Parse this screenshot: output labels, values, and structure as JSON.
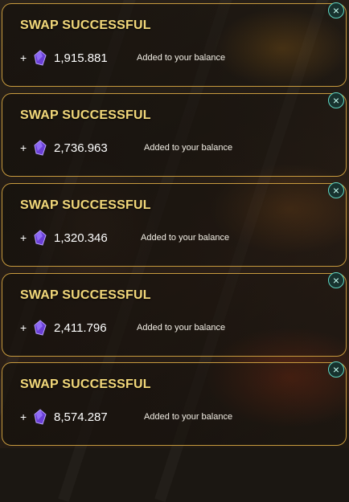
{
  "notifications": [
    {
      "title": "SWAP SUCCESSFUL",
      "plus": "+",
      "amount": "1,915.881",
      "message": "Added to your balance"
    },
    {
      "title": "SWAP SUCCESSFUL",
      "plus": "+",
      "amount": "2,736.963",
      "message": "Added to your balance"
    },
    {
      "title": "SWAP SUCCESSFUL",
      "plus": "+",
      "amount": "1,320.346",
      "message": "Added to your balance"
    },
    {
      "title": "SWAP SUCCESSFUL",
      "plus": "+",
      "amount": "2,411.796",
      "message": "Added to your balance"
    },
    {
      "title": "SWAP SUCCESSFUL",
      "plus": "+",
      "amount": "8,574.287",
      "message": "Added to your balance"
    }
  ],
  "icons": {
    "currency": "purple-gem-icon",
    "close": "close-icon"
  },
  "colors": {
    "title": "#f2d87a",
    "border": "#c79a3e",
    "close_ring": "#5fd6c2",
    "gem": "#6a3fd6"
  }
}
